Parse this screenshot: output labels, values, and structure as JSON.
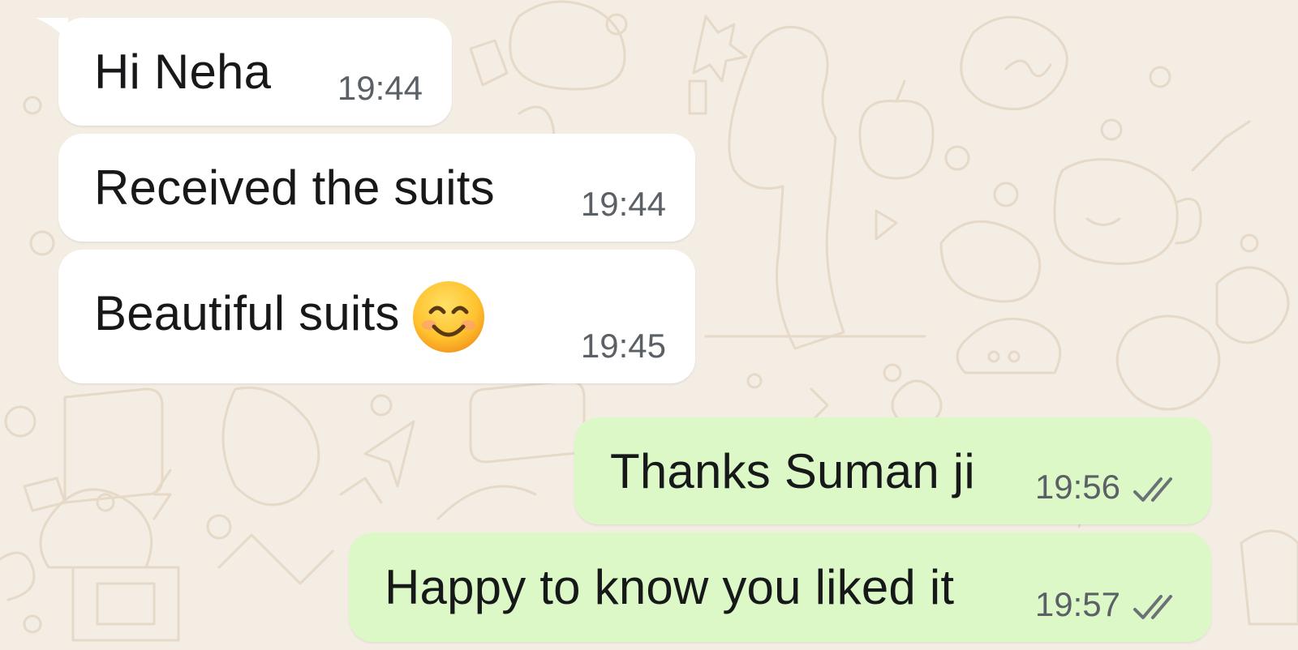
{
  "colors": {
    "background": "#f3ede3",
    "incoming_bubble": "#ffffff",
    "outgoing_bubble": "#dcf8c6",
    "text": "#16181a",
    "time": "#5b6066",
    "tick": "#6b7177"
  },
  "messages": [
    {
      "direction": "incoming",
      "text": "Hi Neha",
      "time": "19:44"
    },
    {
      "direction": "incoming",
      "text": "Received the suits",
      "time": "19:44"
    },
    {
      "direction": "incoming",
      "text": "Beautiful suits",
      "emoji": "smiling-face-with-smiling-eyes",
      "time": "19:45"
    },
    {
      "direction": "outgoing",
      "text": "Thanks Suman ji",
      "time": "19:56",
      "status": "delivered-double-tick"
    },
    {
      "direction": "outgoing",
      "text": "Happy to know you liked it",
      "time": "19:57",
      "status": "delivered-double-tick"
    }
  ]
}
